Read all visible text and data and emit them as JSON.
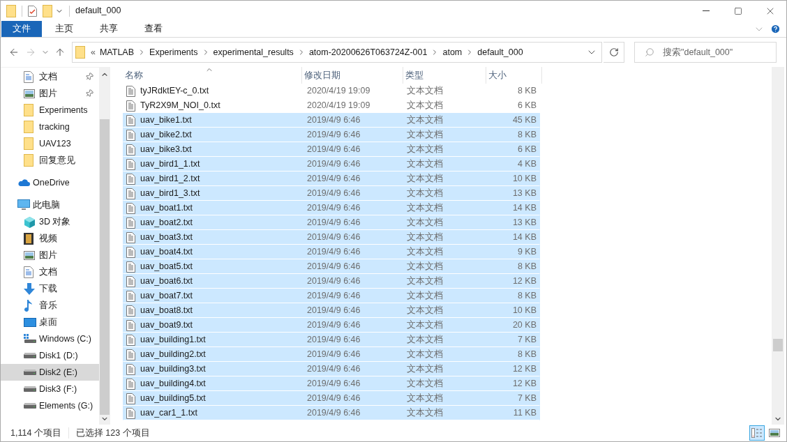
{
  "window": {
    "title": "default_000"
  },
  "ribbon": {
    "tabs": [
      {
        "label": "文件",
        "selected": true
      },
      {
        "label": "主页",
        "selected": false
      },
      {
        "label": "共享",
        "selected": false
      },
      {
        "label": "查看",
        "selected": false
      }
    ]
  },
  "address_bar": {
    "overflow": "«",
    "path": [
      "MATLAB",
      "Experiments",
      "experimental_results",
      "atom-20200626T063724Z-001",
      "atom",
      "default_000"
    ]
  },
  "search": {
    "placeholder": "搜索\"default_000\""
  },
  "sidebar": {
    "items": [
      {
        "label": "文档",
        "kind": "document",
        "pinned": true,
        "selected": false
      },
      {
        "label": "图片",
        "kind": "picture",
        "pinned": true,
        "selected": false
      },
      {
        "label": "Experiments",
        "kind": "folder",
        "selected": false
      },
      {
        "label": "tracking",
        "kind": "folder",
        "selected": false
      },
      {
        "label": "UAV123",
        "kind": "folder",
        "selected": false
      },
      {
        "label": "回复意见",
        "kind": "folder",
        "selected": false
      },
      {
        "label": "OneDrive",
        "kind": "cloud",
        "selected": false,
        "top": true
      },
      {
        "label": "此电脑",
        "kind": "computer",
        "selected": false,
        "top": true,
        "children": [
          {
            "label": "3D 对象",
            "kind": "cube",
            "selected": false
          },
          {
            "label": "视频",
            "kind": "video",
            "selected": false
          },
          {
            "label": "图片",
            "kind": "picture",
            "selected": false
          },
          {
            "label": "文档",
            "kind": "document",
            "selected": false
          },
          {
            "label": "下载",
            "kind": "download",
            "selected": false
          },
          {
            "label": "音乐",
            "kind": "music",
            "selected": false
          },
          {
            "label": "桌面",
            "kind": "desktop",
            "selected": false
          },
          {
            "label": "Windows (C:)",
            "kind": "systemdrive",
            "selected": false
          },
          {
            "label": "Disk1 (D:)",
            "kind": "drive",
            "selected": false
          },
          {
            "label": "Disk2 (E:)",
            "kind": "drive",
            "selected": true
          },
          {
            "label": "Disk3 (F:)",
            "kind": "drive",
            "selected": false
          },
          {
            "label": "Elements (G:)",
            "kind": "drive",
            "selected": false
          }
        ]
      }
    ]
  },
  "table": {
    "columns": [
      "名称",
      "修改日期",
      "类型",
      "大小"
    ],
    "rows": [
      {
        "name": "tyJRdktEY-c_0.txt",
        "date": "2020/4/19 19:09",
        "type": "文本文档",
        "size": "8 KB",
        "selected": false
      },
      {
        "name": "TyR2X9M_NOI_0.txt",
        "date": "2020/4/19 19:09",
        "type": "文本文档",
        "size": "6 KB",
        "selected": false
      },
      {
        "name": "uav_bike1.txt",
        "date": "2019/4/9 6:46",
        "type": "文本文档",
        "size": "45 KB",
        "selected": true
      },
      {
        "name": "uav_bike2.txt",
        "date": "2019/4/9 6:46",
        "type": "文本文档",
        "size": "8 KB",
        "selected": true
      },
      {
        "name": "uav_bike3.txt",
        "date": "2019/4/9 6:46",
        "type": "文本文档",
        "size": "6 KB",
        "selected": true
      },
      {
        "name": "uav_bird1_1.txt",
        "date": "2019/4/9 6:46",
        "type": "文本文档",
        "size": "4 KB",
        "selected": true
      },
      {
        "name": "uav_bird1_2.txt",
        "date": "2019/4/9 6:46",
        "type": "文本文档",
        "size": "10 KB",
        "selected": true
      },
      {
        "name": "uav_bird1_3.txt",
        "date": "2019/4/9 6:46",
        "type": "文本文档",
        "size": "13 KB",
        "selected": true
      },
      {
        "name": "uav_boat1.txt",
        "date": "2019/4/9 6:46",
        "type": "文本文档",
        "size": "14 KB",
        "selected": true
      },
      {
        "name": "uav_boat2.txt",
        "date": "2019/4/9 6:46",
        "type": "文本文档",
        "size": "13 KB",
        "selected": true
      },
      {
        "name": "uav_boat3.txt",
        "date": "2019/4/9 6:46",
        "type": "文本文档",
        "size": "14 KB",
        "selected": true
      },
      {
        "name": "uav_boat4.txt",
        "date": "2019/4/9 6:46",
        "type": "文本文档",
        "size": "9 KB",
        "selected": true
      },
      {
        "name": "uav_boat5.txt",
        "date": "2019/4/9 6:46",
        "type": "文本文档",
        "size": "8 KB",
        "selected": true
      },
      {
        "name": "uav_boat6.txt",
        "date": "2019/4/9 6:46",
        "type": "文本文档",
        "size": "12 KB",
        "selected": true
      },
      {
        "name": "uav_boat7.txt",
        "date": "2019/4/9 6:46",
        "type": "文本文档",
        "size": "8 KB",
        "selected": true
      },
      {
        "name": "uav_boat8.txt",
        "date": "2019/4/9 6:46",
        "type": "文本文档",
        "size": "10 KB",
        "selected": true
      },
      {
        "name": "uav_boat9.txt",
        "date": "2019/4/9 6:46",
        "type": "文本文档",
        "size": "20 KB",
        "selected": true
      },
      {
        "name": "uav_building1.txt",
        "date": "2019/4/9 6:46",
        "type": "文本文档",
        "size": "7 KB",
        "selected": true
      },
      {
        "name": "uav_building2.txt",
        "date": "2019/4/9 6:46",
        "type": "文本文档",
        "size": "8 KB",
        "selected": true
      },
      {
        "name": "uav_building3.txt",
        "date": "2019/4/9 6:46",
        "type": "文本文档",
        "size": "12 KB",
        "selected": true
      },
      {
        "name": "uav_building4.txt",
        "date": "2019/4/9 6:46",
        "type": "文本文档",
        "size": "12 KB",
        "selected": true
      },
      {
        "name": "uav_building5.txt",
        "date": "2019/4/9 6:46",
        "type": "文本文档",
        "size": "7 KB",
        "selected": true
      },
      {
        "name": "uav_car1_1.txt",
        "date": "2019/4/9 6:46",
        "type": "文本文档",
        "size": "11 KB",
        "selected": true
      }
    ]
  },
  "status_bar": {
    "item_count": "1,114 个项目",
    "selection": "已选择 123 个项目"
  },
  "view_buttons": [
    {
      "kind": "details",
      "selected": true
    },
    {
      "kind": "thumbnails",
      "selected": false
    }
  ]
}
